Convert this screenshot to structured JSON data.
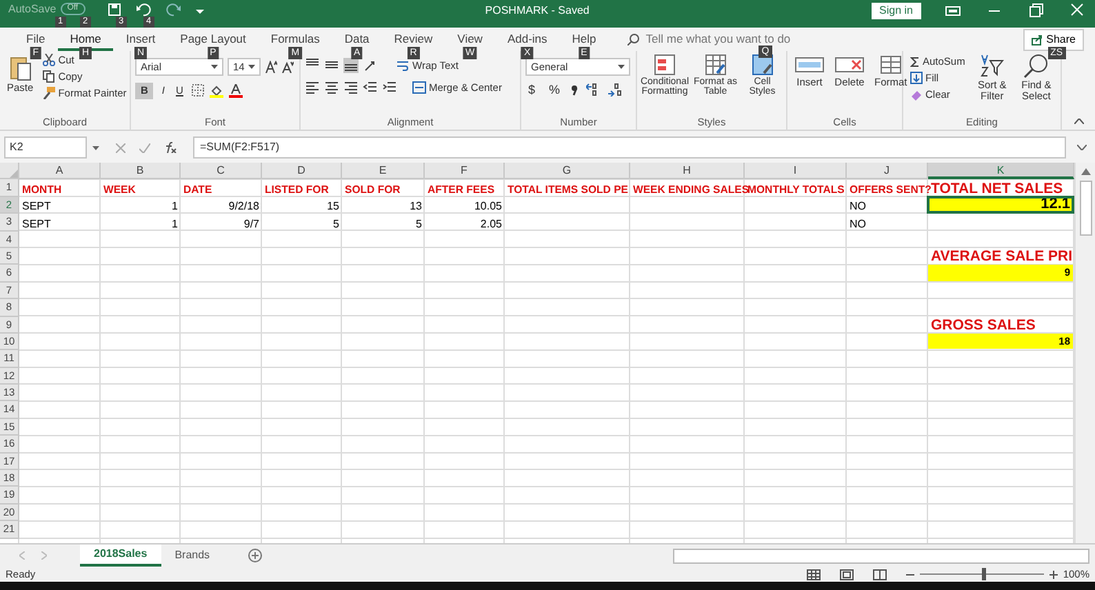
{
  "title_bar": {
    "autosave": "AutoSave",
    "autosave_state": "Off",
    "title": "POSHMARK  -  Saved",
    "sign_in": "Sign in",
    "keytips": [
      "1",
      "2",
      "3",
      "4"
    ]
  },
  "tabs": [
    {
      "label": "File",
      "keytip": "F",
      "selected": false
    },
    {
      "label": "Home",
      "keytip": "H",
      "selected": true
    },
    {
      "label": "Insert",
      "keytip": "N",
      "selected": false
    },
    {
      "label": "Page Layout",
      "keytip": "P",
      "selected": false
    },
    {
      "label": "Formulas",
      "keytip": "M",
      "selected": false
    },
    {
      "label": "Data",
      "keytip": "A",
      "selected": false
    },
    {
      "label": "Review",
      "keytip": "R",
      "selected": false
    },
    {
      "label": "View",
      "keytip": "W",
      "selected": false
    },
    {
      "label": "Add-ins",
      "keytip": "X",
      "selected": false
    },
    {
      "label": "Help",
      "keytip": "E",
      "selected": false
    }
  ],
  "tell_me": {
    "placeholder": "Tell me what you want to do",
    "keytip": "Q"
  },
  "share": {
    "label": "Share",
    "keytip": "ZS"
  },
  "clipboard": {
    "paste": "Paste",
    "cut": "Cut",
    "copy": "Copy",
    "format_painter": "Format Painter",
    "label": "Clipboard"
  },
  "font": {
    "name": "Arial",
    "size": "14",
    "bold_glyph": "B",
    "italic_glyph": "I",
    "underline_glyph": "U",
    "bold": true,
    "label": "Font"
  },
  "alignment": {
    "vertical_align": [
      {
        "selected": false
      },
      {
        "selected": false
      },
      {
        "selected": true
      }
    ],
    "wrap_text": "Wrap Text",
    "merge_center": "Merge & Center",
    "label": "Alignment"
  },
  "number": {
    "format": "General",
    "currency": "$",
    "percent": "%",
    "label": "Number"
  },
  "styles": {
    "buttons": [
      "Conditional Formatting",
      "Format as Table",
      "Cell Styles"
    ],
    "label": "Styles"
  },
  "cells_group": {
    "buttons": [
      "Insert",
      "Delete",
      "Format"
    ],
    "label": "Cells"
  },
  "editing": {
    "autosum": "AutoSum",
    "fill": "Fill",
    "clear": "Clear",
    "sort_filter": "Sort & Filter",
    "find_select": "Find & Select",
    "label": "Editing"
  },
  "formula_bar": {
    "name_box": "K2",
    "formula": "=SUM(F2:F517)"
  },
  "columns": [
    "A",
    "B",
    "C",
    "D",
    "E",
    "F",
    "G",
    "H",
    "I",
    "J",
    "K"
  ],
  "rows": [
    {
      "number": "1",
      "cells": {
        "A": {
          "text": "MONTH",
          "kind": "header"
        },
        "B": {
          "text": "WEEK",
          "kind": "header"
        },
        "C": {
          "text": "DATE",
          "kind": "header"
        },
        "D": {
          "text": "LISTED FOR",
          "kind": "header"
        },
        "E": {
          "text": "SOLD FOR",
          "kind": "header"
        },
        "F": {
          "text": "AFTER FEES",
          "kind": "header"
        },
        "G": {
          "text": "TOTAL ITEMS SOLD PE",
          "kind": "header"
        },
        "H": {
          "text": "WEEK ENDING SALES",
          "kind": "header"
        },
        "I": {
          "text": "MONTHLY TOTALS",
          "kind": "header"
        },
        "J": {
          "text": "OFFERS SENT?",
          "kind": "header"
        },
        "K": {
          "text": "TOTAL NET SALES",
          "kind": "title"
        }
      }
    },
    {
      "number": "2",
      "cells": {
        "A": {
          "text": "SEPT",
          "kind": "text"
        },
        "B": {
          "text": "1",
          "kind": "number"
        },
        "C": {
          "text": "9/2/18",
          "kind": "number"
        },
        "D": {
          "text": "15",
          "kind": "number"
        },
        "E": {
          "text": "13",
          "kind": "number"
        },
        "F": {
          "text": "10.05",
          "kind": "number"
        },
        "J": {
          "text": "NO",
          "kind": "text"
        },
        "K": {
          "text": "12.1",
          "kind": "total",
          "selected": true
        }
      }
    },
    {
      "number": "3",
      "cells": {
        "A": {
          "text": "SEPT",
          "kind": "text"
        },
        "B": {
          "text": "1",
          "kind": "number"
        },
        "C": {
          "text": "9/7",
          "kind": "number"
        },
        "D": {
          "text": "5",
          "kind": "number"
        },
        "E": {
          "text": "5",
          "kind": "number"
        },
        "F": {
          "text": "2.05",
          "kind": "number"
        },
        "J": {
          "text": "NO",
          "kind": "text"
        }
      }
    },
    {
      "number": "4"
    },
    {
      "number": "5",
      "cells": {
        "K": {
          "text": "AVERAGE SALE PRI",
          "kind": "title"
        }
      }
    },
    {
      "number": "6",
      "cells": {
        "K": {
          "text": "9",
          "kind": "highlight"
        }
      }
    },
    {
      "number": "7"
    },
    {
      "number": "8"
    },
    {
      "number": "9",
      "cells": {
        "K": {
          "text": "GROSS SALES",
          "kind": "title"
        }
      }
    },
    {
      "number": "10",
      "cells": {
        "K": {
          "text": "18",
          "kind": "highlight"
        }
      }
    },
    {
      "number": "11"
    },
    {
      "number": "12"
    },
    {
      "number": "13"
    },
    {
      "number": "14"
    },
    {
      "number": "15"
    },
    {
      "number": "16"
    },
    {
      "number": "17"
    },
    {
      "number": "18"
    },
    {
      "number": "19"
    },
    {
      "number": "20"
    },
    {
      "number": "21"
    }
  ],
  "sheet_tabs": [
    {
      "label": "2018Sales",
      "selected": true
    },
    {
      "label": "Brands",
      "selected": false
    }
  ],
  "status_bar": {
    "status": "Ready",
    "zoom": "100%"
  },
  "zoom_slider": {
    "level": 0.5
  }
}
